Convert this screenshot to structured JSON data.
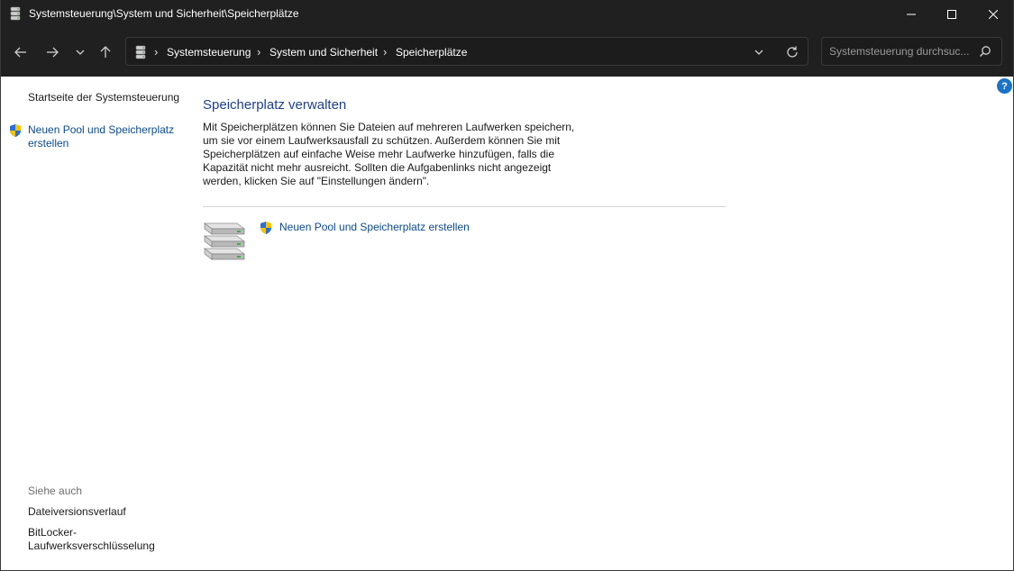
{
  "window": {
    "title": "Systemsteuerung\\System und Sicherheit\\Speicherplätze",
    "icon": "storage-spaces-icon"
  },
  "nav": {
    "back_icon": "arrow-left-icon",
    "forward_icon": "arrow-right-icon",
    "recent_icon": "chevron-down-icon",
    "up_icon": "arrow-up-icon"
  },
  "address": {
    "breadcrumbs": [
      "Systemsteuerung",
      "System und Sicherheit",
      "Speicherplätze"
    ],
    "separator": "›"
  },
  "search": {
    "placeholder": "Systemsteuerung durchsuc..."
  },
  "sidebar": {
    "home_link": "Startseite der Systemsteuerung",
    "task_link_line1": "Neuen Pool und Speicherplatz",
    "task_link_line2": "erstellen",
    "see_also_label": "Siehe auch",
    "see_also_1": "Dateiversionsverlauf",
    "see_also_2_line1": "BitLocker-",
    "see_also_2_line2": "Laufwerksverschlüsselung"
  },
  "main": {
    "heading": "Speicherplatz verwalten",
    "description": "Mit Speicherplätzen können Sie Dateien auf mehreren Laufwerken speichern,\num sie vor einem Laufwerksausfall zu schützen. Außerdem können Sie mit\nSpeicherplätzen auf einfache Weise mehr Laufwerke hinzufügen, falls die\nKapazität nicht mehr ausreicht. Sollten die Aufgabenlinks nicht angezeigt\nwerden, klicken Sie auf \"Einstellungen ändern\".",
    "create_link": "Neuen Pool und Speicherplatz erstellen",
    "help": "?"
  },
  "colors": {
    "titlebar": "#202020",
    "link": "#0b4a8b",
    "heading": "#1e3f8a",
    "help": "#1a73c8"
  }
}
